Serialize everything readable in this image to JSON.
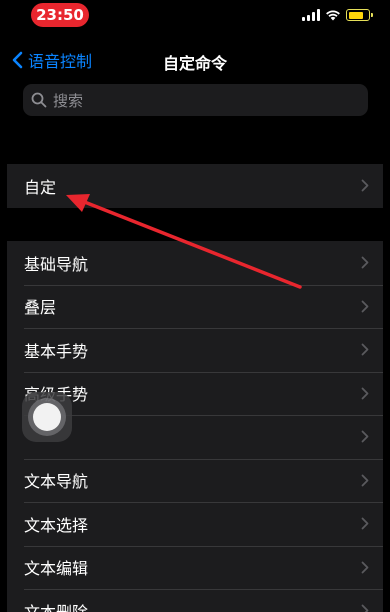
{
  "status_bar": {
    "time": "23:50"
  },
  "nav": {
    "back_label": "语音控制",
    "title": "自定命令"
  },
  "search": {
    "placeholder": "搜索"
  },
  "group1": {
    "items": [
      {
        "label": "自定"
      }
    ]
  },
  "group2": {
    "items": [
      {
        "label": "基础导航"
      },
      {
        "label": "叠层"
      },
      {
        "label": "基本手势"
      },
      {
        "label": "高级手势"
      },
      {
        "label": ""
      },
      {
        "label": "文本导航"
      },
      {
        "label": "文本选择"
      },
      {
        "label": "文本编辑"
      },
      {
        "label": "文本删除"
      }
    ]
  },
  "colors": {
    "accent": "#0a84ff",
    "annotation": "#e8262e",
    "battery": "#ffd60a"
  }
}
